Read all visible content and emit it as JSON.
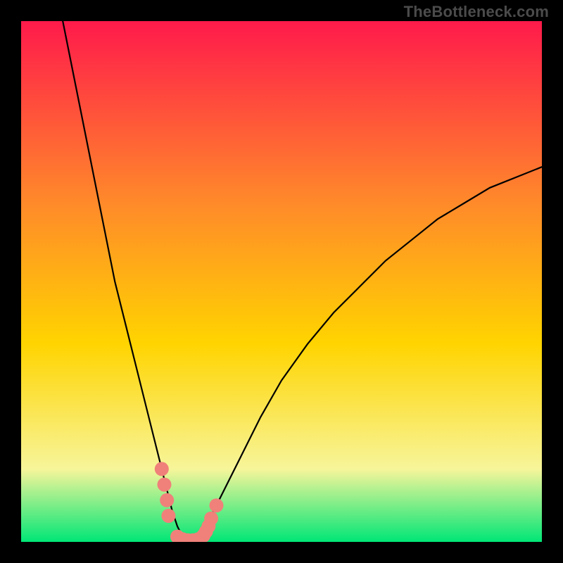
{
  "watermark": "TheBottleneck.com",
  "chart_data": {
    "type": "line",
    "title": "",
    "xlabel": "",
    "ylabel": "",
    "xlim": [
      0,
      100
    ],
    "ylim": [
      0,
      100
    ],
    "grid": false,
    "legend": false,
    "background_gradient": {
      "top_color": "#ff1a4b",
      "mid_color": "#ffd400",
      "bottom_color": "#00e676"
    },
    "series": [
      {
        "name": "bottleneck-curve",
        "color": "#000000",
        "x": [
          8,
          10,
          12,
          14,
          16,
          18,
          20,
          22,
          24,
          26,
          27,
          28,
          29,
          30,
          31,
          32,
          33,
          34,
          35,
          36,
          38,
          42,
          46,
          50,
          55,
          60,
          65,
          70,
          75,
          80,
          85,
          90,
          95,
          100
        ],
        "values": [
          100,
          90,
          80,
          70,
          60,
          50,
          42,
          34,
          26,
          18,
          14,
          10,
          6,
          3,
          1,
          0,
          0,
          1,
          2,
          4,
          8,
          16,
          24,
          31,
          38,
          44,
          49,
          54,
          58,
          62,
          65,
          68,
          70,
          72
        ]
      }
    ],
    "scatter_overlay": {
      "name": "highlight-points",
      "color": "#f0807a",
      "radius_px": 10,
      "points": [
        {
          "x": 27.0,
          "y": 14
        },
        {
          "x": 27.5,
          "y": 11
        },
        {
          "x": 28.0,
          "y": 8
        },
        {
          "x": 28.3,
          "y": 5
        },
        {
          "x": 30.0,
          "y": 1
        },
        {
          "x": 31.0,
          "y": 0.5
        },
        {
          "x": 32.0,
          "y": 0.3
        },
        {
          "x": 33.0,
          "y": 0.3
        },
        {
          "x": 34.0,
          "y": 0.5
        },
        {
          "x": 35.0,
          "y": 1.2
        },
        {
          "x": 35.5,
          "y": 2
        },
        {
          "x": 36.0,
          "y": 3
        },
        {
          "x": 36.5,
          "y": 4.5
        },
        {
          "x": 37.5,
          "y": 7
        }
      ]
    }
  }
}
